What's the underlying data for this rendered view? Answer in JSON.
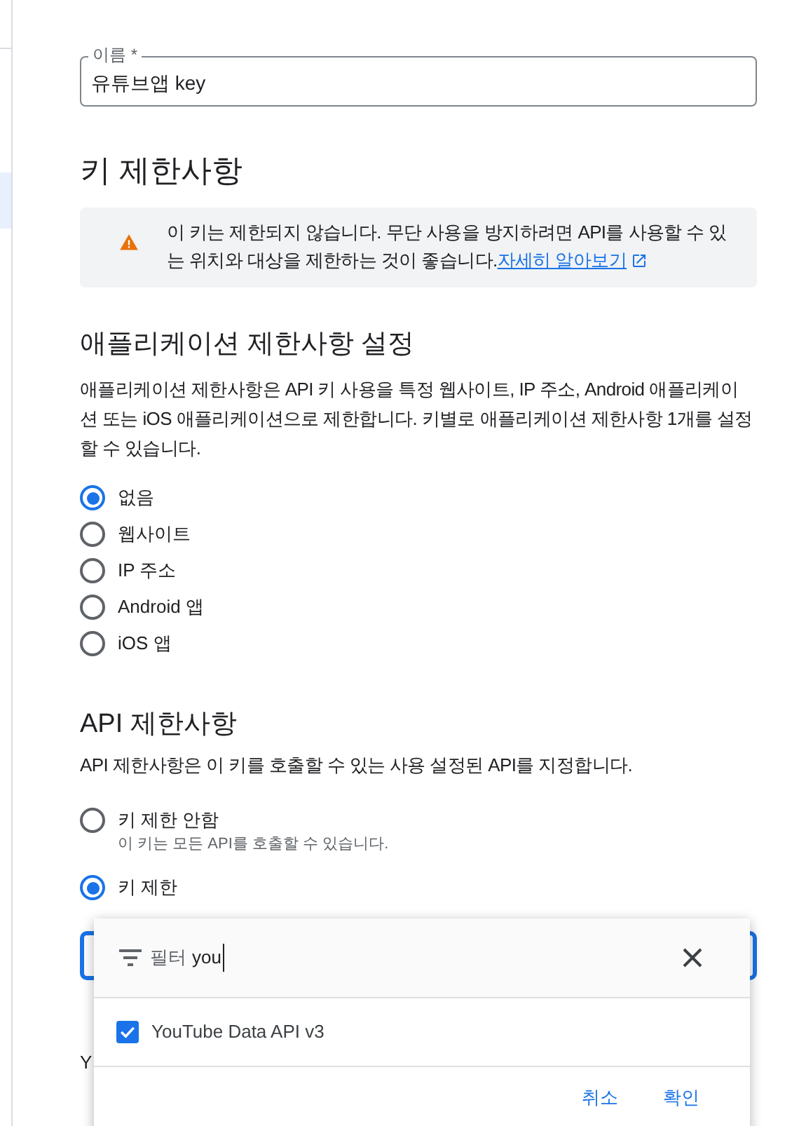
{
  "name_field": {
    "label": "이름 *",
    "value": "유튜브앱 key"
  },
  "key_restrictions": {
    "title": "키 제한사항",
    "warning": {
      "text": "이 키는 제한되지 않습니다. 무단 사용을 방지하려면 API를 사용할 수 있는 위치와 대상을 제한하는 것이 좋습니다.",
      "link": "자세히 알아보기"
    }
  },
  "application_restrictions": {
    "title": "애플리케이션 제한사항 설정",
    "description": "애플리케이션 제한사항은 API 키 사용을 특정 웹사이트, IP 주소, Android 애플리케이션 또는 iOS 애플리케이션으로 제한합니다. 키별로 애플리케이션 제한사항 1개를 설정할 수 있습니다.",
    "options": [
      {
        "label": "없음",
        "selected": true
      },
      {
        "label": "웹사이트",
        "selected": false
      },
      {
        "label": "IP 주소",
        "selected": false
      },
      {
        "label": "Android 앱",
        "selected": false
      },
      {
        "label": "iOS 앱",
        "selected": false
      }
    ]
  },
  "api_restrictions": {
    "title": "API 제한사항",
    "description": "API 제한사항은 이 키를 호출할 수 있는 사용 설정된 API를 지정합니다.",
    "options": [
      {
        "label": "키 제한 안함",
        "hint": "이 키는 모든 API를 호출할 수 있습니다.",
        "selected": false
      },
      {
        "label": "키 제한",
        "selected": true
      }
    ],
    "covered_texts": [
      "Y"
    ]
  },
  "filter_popup": {
    "filter_label": "필터",
    "query": "you",
    "items": [
      {
        "label": "YouTube Data API v3",
        "checked": true
      }
    ],
    "buttons": [
      "취소",
      "확인"
    ]
  }
}
